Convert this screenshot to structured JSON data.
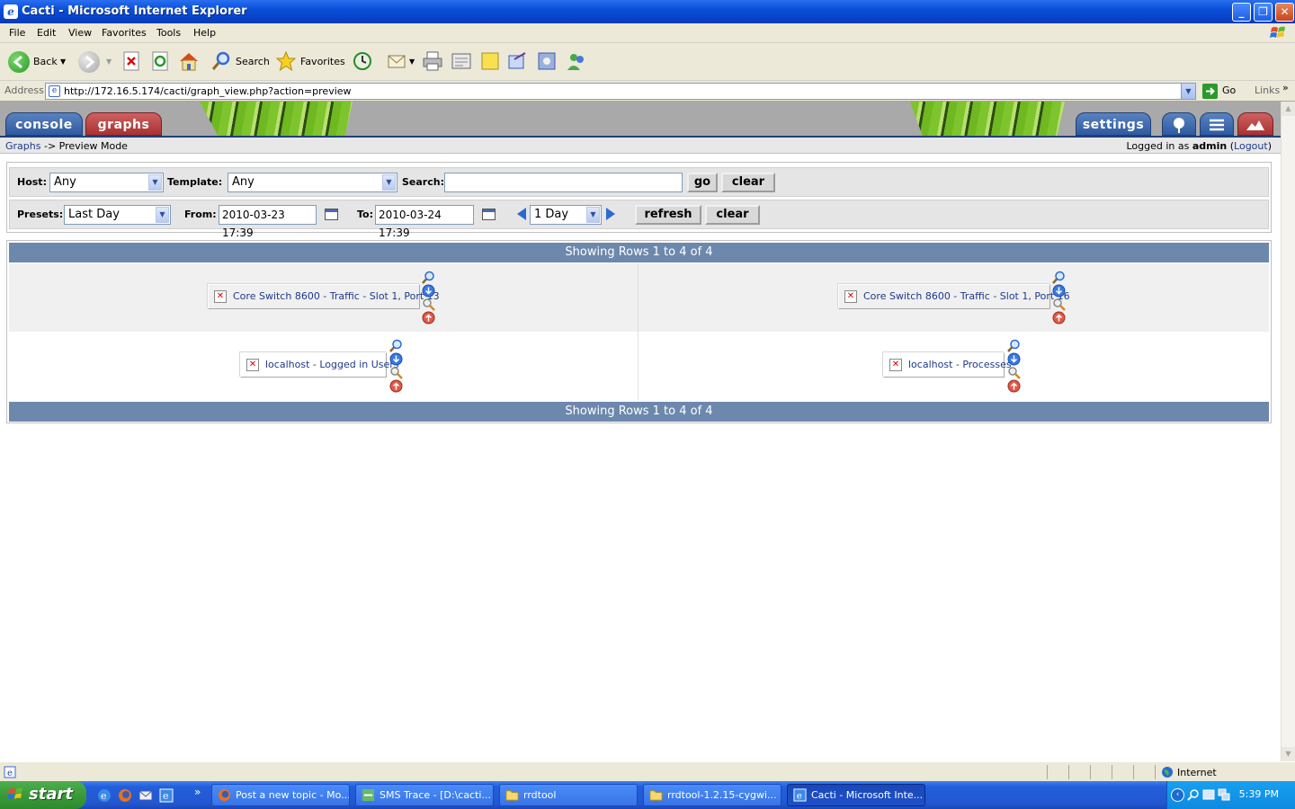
{
  "window": {
    "title": "Cacti - Microsoft Internet Explorer"
  },
  "menu": [
    "File",
    "Edit",
    "View",
    "Favorites",
    "Tools",
    "Help"
  ],
  "toolbar": {
    "back": "Back",
    "search": "Search",
    "favorites": "Favorites"
  },
  "address": {
    "label": "Address",
    "url": "http://172.16.5.174/cacti/graph_view.php?action=preview",
    "go": "Go",
    "links": "Links"
  },
  "cacti": {
    "tabs": {
      "console": "console",
      "graphs": "graphs",
      "settings": "settings"
    },
    "breadcrumb": {
      "link": "Graphs",
      "rest": "-> Preview Mode"
    },
    "login": {
      "prefix": "Logged in as",
      "user": "admin",
      "open": "(",
      "logout": "Logout",
      "close": ")"
    }
  },
  "filter": {
    "host_label": "Host:",
    "host_value": "Any",
    "template_label": "Template:",
    "template_value": "Any",
    "search_label": "Search:",
    "search_value": "",
    "go": "go",
    "clear": "clear",
    "presets_label": "Presets:",
    "presets_value": "Last Day",
    "from_label": "From:",
    "from_value": "2010-03-23 17:39",
    "to_label": "To:",
    "to_value": "2010-03-24 17:39",
    "timespan_value": "1 Day",
    "refresh": "refresh",
    "clear2": "clear"
  },
  "results": {
    "header": "Showing Rows 1 to 4 of 4",
    "footer": "Showing Rows 1 to 4 of 4",
    "graphs": [
      "Core Switch 8600 - Traffic - Slot 1, Port 13",
      "Core Switch 8600 - Traffic - Slot 1, Port 16",
      "localhost - Logged in Users",
      "localhost - Processes"
    ]
  },
  "status": {
    "zone": "Internet"
  },
  "taskbar": {
    "start": "start",
    "tasks": [
      "Post a new topic - Mo...",
      "SMS Trace - [D:\\cacti...",
      "rrdtool",
      "rrdtool-1.2.15-cygwi...",
      "Cacti - Microsoft Inte..."
    ],
    "clock": "5:39 PM"
  },
  "colors": {
    "titlebar": "#0a4fd8",
    "tab_blue": "#2f5aa0",
    "tab_red": "#a83232",
    "table_header": "#6d88ad",
    "link": "#1d3a8a"
  }
}
